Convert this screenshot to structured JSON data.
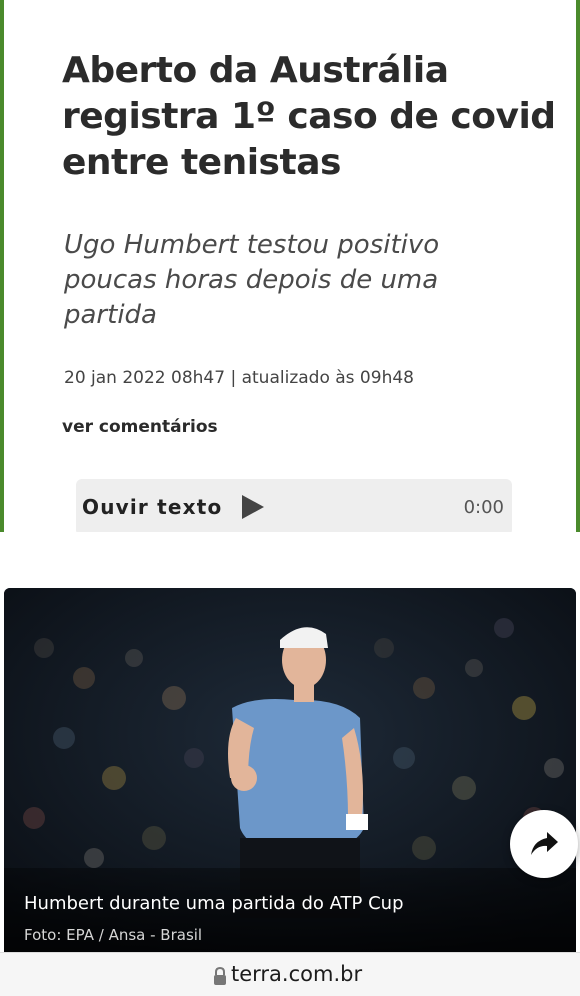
{
  "article": {
    "title": "Aberto da Austrália registra 1º caso de covid entre tenistas",
    "subtitle": "Ugo Humbert testou positivo poucas horas depois de uma partida",
    "meta": "20 jan 2022 08h47 | atualizado às 09h48",
    "comments_link": "ver comentários",
    "accent_color": "#4a8a2c"
  },
  "audio_player": {
    "label": "Ouvir texto",
    "icon": "play-icon",
    "time": "0:00"
  },
  "photo": {
    "caption": "Humbert durante uma partida do ATP Cup",
    "credit": "Foto: EPA / Ansa - Brasil",
    "share_icon": "share-icon"
  },
  "browser": {
    "url": "terra.com.br",
    "lock_icon": "lock-icon"
  }
}
